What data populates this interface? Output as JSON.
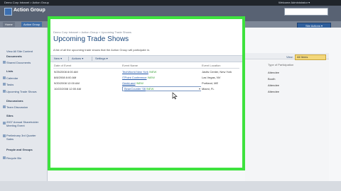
{
  "topbar": {
    "crumb": "Demo Corp Intranet > Action Group",
    "welcome": "Welcome Administrator ▾"
  },
  "header": {
    "site_title": "Action Group"
  },
  "tabs": {
    "home": "Home",
    "active": "Action Group"
  },
  "site_actions": "Site Actions ▾",
  "leftnav": {
    "view_all": "View All Site Content",
    "sections": [
      {
        "title": "Documents",
        "items": [
          "Shared Documents"
        ]
      },
      {
        "title": "Lists",
        "items": [
          "Calendar",
          "Tasks",
          "Upcoming Trade Shows"
        ]
      },
      {
        "title": "Discussions",
        "items": [
          "Team Discussion"
        ]
      },
      {
        "title": "Sites",
        "items": [
          "2007 Annual Shareholder Meeting Event",
          "Preliminary 3rd Quarter Sales"
        ]
      },
      {
        "title": "People and Groups",
        "items": []
      }
    ],
    "recycle": "Recycle Bin"
  },
  "page": {
    "breadcrumb": "Demo Corp Intranet > Action Group > Upcoming Trade Shows",
    "title": "Upcoming Trade Shows",
    "description": "A list of all the upcoming trade shows that the Action Group will participate in."
  },
  "toolbar": {
    "new": "New ▾",
    "actions": "Actions ▾",
    "settings": "Settings ▾"
  },
  "view": {
    "label": "View:",
    "selected": "All Items"
  },
  "columns": {
    "date": "Date of Event",
    "name": "Event Name",
    "location": "Event Location",
    "type": "Type of Participation"
  },
  "rows": [
    {
      "date": "9/25/2008 8:00 AM",
      "name": "TechWorld New York",
      "location": "Javits Center, New York",
      "type": "Attendee"
    },
    {
      "date": "8/8/2008 8:00 AM",
      "name": "ITPoint Conference",
      "location": "Las Vegas, NV",
      "type": "Booth"
    },
    {
      "date": "9/20/2008 12:00 AM",
      "name": "GeekLand",
      "location": "Portland, ME",
      "type": "Attendee"
    },
    {
      "date": "10/22/2008 12:00 AM",
      "name": "BeanCounter '08",
      "location": "Miami, FL",
      "type": "Attendee"
    }
  ],
  "new_badge": "!NEW",
  "colors": {
    "highlight": "#3ee23e",
    "title_blue": "#1e4a7e",
    "link_blue": "#1f56a8"
  }
}
